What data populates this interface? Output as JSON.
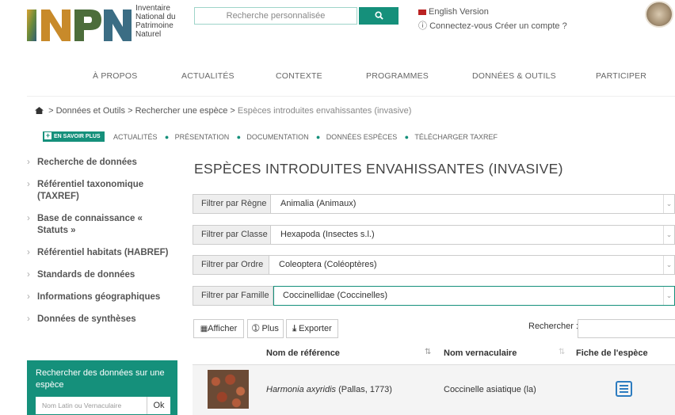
{
  "header": {
    "logo_letters": "INPN",
    "logo_lines": [
      "Inventaire",
      "National du",
      "Patrimoine",
      "Naturel"
    ],
    "search_placeholder": "Recherche personnalisée",
    "english_link": "English Version",
    "account_text": "Connectez-vous Créer un compte ?",
    "colors": {
      "accent": "#15907b",
      "link_blue": "#2d7cc0"
    }
  },
  "nav": [
    "À PROPOS",
    "ACTUALITÉS",
    "CONTEXTE",
    "PROGRAMMES",
    "DONNÉES & OUTILS",
    "PARTICIPER"
  ],
  "breadcrumb": {
    "items": [
      "Données et Outils",
      "Rechercher une espèce",
      "Espèces introduites envahissantes (invasive)"
    ],
    "separator": ">"
  },
  "subnav": {
    "button": "EN SAVOIR PLUS",
    "items": [
      "ACTUALITÉS",
      "PRÉSENTATION",
      "DOCUMENTATION",
      "DONNÉES ESPÈCES",
      "TÉLÉCHARGER TAXREF"
    ]
  },
  "sidebar": {
    "items": [
      "Recherche de données",
      "Référentiel taxonomique (TAXREF)",
      "Base de connaissance « Statuts »",
      "Référentiel habitats (HABREF)",
      "Standards de données",
      "Informations géographiques",
      "Données de synthèses"
    ],
    "box_title": "Rechercher des données sur une espèce",
    "box_placeholder": "Nom Latin ou Vernaculaire",
    "box_button": "Ok"
  },
  "main": {
    "title": "ESPÈCES INTRODUITES ENVAHISSANTES (INVASIVE)",
    "filters": [
      {
        "label": "Filtrer par Règne",
        "value": "Animalia (Animaux)"
      },
      {
        "label": "Filtrer par Classe",
        "value": "Hexapoda (Insectes s.l.)"
      },
      {
        "label": "Filtrer par Ordre",
        "value": "Coleoptera (Coléoptères)"
      },
      {
        "label": "Filtrer par Famille",
        "value": "Coccinellidae (Coccinelles)"
      }
    ],
    "toolbar": {
      "afficher": "Afficher",
      "plus": "Plus",
      "exporter": "Exporter",
      "search_label": "Rechercher :"
    },
    "table": {
      "headers": [
        "Nom de référence",
        "Nom vernaculaire",
        "Fiche de l'espèce"
      ],
      "rows": [
        {
          "scientific": "Harmonia axyridis",
          "authority": "(Pallas, 1773)",
          "vernacular": "Coccinelle asiatique (la)"
        }
      ]
    }
  }
}
